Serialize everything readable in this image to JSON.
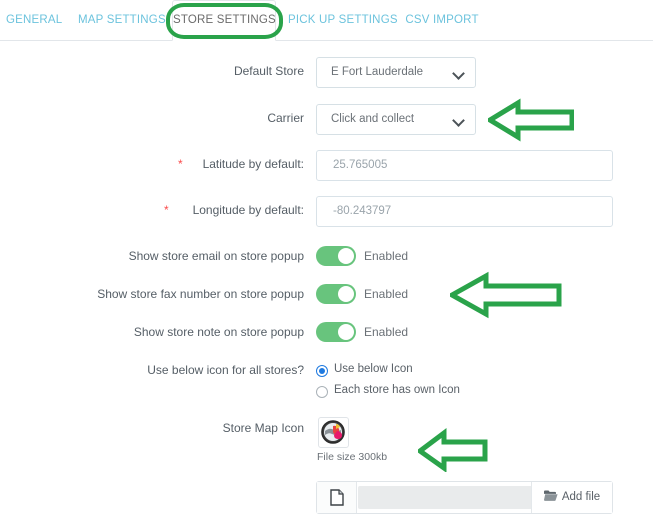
{
  "tabs": [
    {
      "label": "GENERAL",
      "active": false
    },
    {
      "label": "MAP SETTINGS",
      "active": false
    },
    {
      "label": "STORE SETTINGS",
      "active": true
    },
    {
      "label": "PICK UP SETTINGS",
      "active": false
    },
    {
      "label": "CSV IMPORT",
      "active": false
    }
  ],
  "form": {
    "default_store": {
      "label": "Default Store",
      "value": "E Fort Lauderdale"
    },
    "carrier": {
      "label": "Carrier",
      "value": "Click and collect"
    },
    "latitude": {
      "label": "Latitude by default:",
      "required_mark": "*",
      "value": "25.765005"
    },
    "longitude": {
      "label": "Longitude by default:",
      "required_mark": "*",
      "value": "-80.243797"
    },
    "show_email": {
      "label": "Show store email on store popup",
      "state": "Enabled"
    },
    "show_fax": {
      "label": "Show store fax number on store popup",
      "state": "Enabled"
    },
    "show_note": {
      "label": "Show store note on store popup",
      "state": "Enabled"
    },
    "use_icon": {
      "label": "Use below icon for all stores?",
      "options": [
        {
          "label": "Use below Icon",
          "selected": true
        },
        {
          "label": "Each store has own Icon",
          "selected": false
        }
      ]
    },
    "store_map_icon": {
      "label": "Store Map Icon",
      "file_size_note": "File size 300kb",
      "thumb_icon": "map-pin-globe-icon"
    },
    "file_upload": {
      "file_icon": "document-icon",
      "field_value": "",
      "button_label": "Add file",
      "button_icon": "open-folder-icon"
    }
  },
  "annotations": {
    "accent_color": "#2aa34a",
    "arrows": [
      {
        "name": "arrow-carrier",
        "direction": "left"
      },
      {
        "name": "arrow-show-fax",
        "direction": "left"
      },
      {
        "name": "arrow-file-size",
        "direction": "left"
      }
    ],
    "tab_highlight": "STORE SETTINGS"
  },
  "colors": {
    "tab_link": "#6cc3dd",
    "toggle_on": "#68c47d",
    "radio_selected": "#1f7ae0",
    "required_star": "#fa4b4b"
  }
}
